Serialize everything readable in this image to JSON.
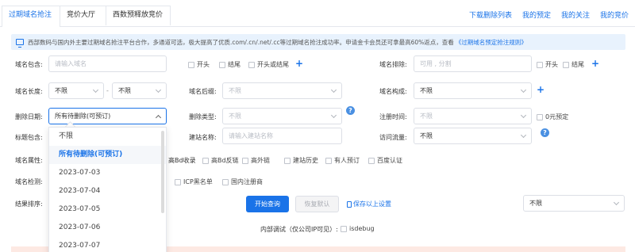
{
  "tabs": [
    "过期域名抢注",
    "竞价大厅",
    "西数预释放竞价"
  ],
  "top_links": [
    "下载删除列表",
    "我的预定",
    "我的关注",
    "我的竞价"
  ],
  "notice": {
    "text": "西部数码与国内外主要过期域名抢注平台合作，多通道可选，极大提高了优质.com/.cn/.net/.cc等过期域名抢注成功率。申请金卡会员还可拿最高60%返点，查看",
    "link": "《过期域名预定抢注规则》"
  },
  "form": {
    "domain_contains_label": "域名包含:",
    "domain_contains_placeholder": "请输入域名",
    "starts": "开头",
    "ends": "结尾",
    "starts_or_ends": "开头或结尾",
    "domain_exclude_label": "域名排除:",
    "domain_exclude_placeholder": "可用 , 分割",
    "length_label": "域名长度:",
    "length_from": "不限",
    "length_to": "不限",
    "length_sep": "-",
    "suffix_label": "域名后缀:",
    "suffix_value": "不限",
    "composition_label": "域名构成:",
    "composition_value": "不限",
    "delete_date_label": "删除日期:",
    "delete_date_value": "所有待删除(可预订)",
    "delete_type_label": "删除类型:",
    "delete_type_value": "不限",
    "reg_time_label": "注册时间:",
    "reg_time_value": "不限",
    "zero_yuan": "0元预定",
    "title_contains_label": "标题包含:",
    "site_name_label": "建站名称:",
    "site_name_placeholder": "请输入建站名称",
    "traffic_label": "访问流量:",
    "traffic_value": "不限",
    "attr_label": "域名属性:",
    "attr_options": [
      "高Bd收录",
      "高Bd反链",
      "高外链",
      "建站历史",
      "有人预订",
      "百度认证"
    ],
    "detect_label": "域名检测:",
    "detect_options": [
      "ICP黑名单",
      "国内注册商"
    ],
    "sort_label": "结果排序:",
    "sort_right_value": "不限"
  },
  "buttons": {
    "search": "开始查询",
    "reset": "恢复默认",
    "save": "保存以上设置"
  },
  "debug": {
    "label": "内部调试（仅公司IP可见）:",
    "option": "isdebug"
  },
  "dropdown": {
    "items": [
      "不限",
      "所有待删除(可预订)",
      "2023-07-03",
      "2023-07-04",
      "2023-07-05",
      "2023-07-06",
      "2023-07-07"
    ],
    "selected": "所有待删除(可预订)"
  },
  "colors": {
    "accent": "#1a73e8",
    "notice_bg": "#e8f2fd"
  }
}
